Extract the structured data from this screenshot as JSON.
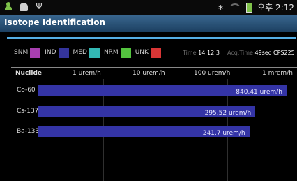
{
  "status": {
    "time": "오후 2:12"
  },
  "title": "Isotope Identification",
  "legend": [
    {
      "label": "SNM",
      "color": "#a83fb0"
    },
    {
      "label": "IND",
      "color": "#34349c"
    },
    {
      "label": "MED",
      "color": "#33b9b5"
    },
    {
      "label": "NRM",
      "color": "#54c43f"
    },
    {
      "label": "UNK",
      "color": "#d93636"
    }
  ],
  "info": {
    "time_label": "Time",
    "time_value": "14:12:3",
    "acq_label": "Acq.Time",
    "acq_value": "49sec",
    "cps_label": "CPS",
    "cps_value": "225"
  },
  "table": {
    "nuclide_header": "Nuclide",
    "scale_headers": [
      "1 urem/h",
      "10 urem/h",
      "100 urem/h",
      "1 mrem/h"
    ]
  },
  "chart_data": {
    "type": "bar",
    "orientation": "horizontal",
    "scale": "log",
    "unit": "urem/h",
    "categories": [
      "Co-60",
      "Cs-137",
      "Ba-133"
    ],
    "values": [
      840.41,
      295.52,
      241.7
    ],
    "value_labels": [
      "840.41 urem/h",
      "295.52 urem/h",
      "241.7 urem/h"
    ],
    "tick_labels": [
      "1 urem/h",
      "10 urem/h",
      "100 urem/h",
      "1 mrem/h"
    ]
  }
}
